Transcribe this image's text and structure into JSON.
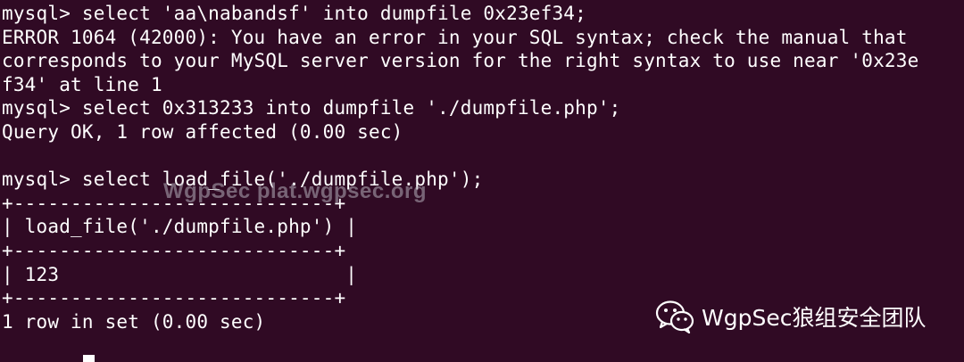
{
  "terminal": {
    "lines": [
      "mysql> select 'aa\\nabandsf' into dumpfile 0x23ef34;",
      "ERROR 1064 (42000): You have an error in your SQL syntax; check the manual that",
      "corresponds to your MySQL server version for the right syntax to use near '0x23e",
      "f34' at line 1",
      "mysql> select 0x313233 into dumpfile './dumpfile.php';",
      "Query OK, 1 row affected (0.00 sec)",
      "",
      "mysql> select load_file('./dumpfile.php');",
      "+----------------------------+",
      "| load_file('./dumpfile.php') |",
      "+----------------------------+",
      "| 123                         |",
      "+----------------------------+",
      "1 row in set (0.00 sec)"
    ],
    "background": "#300a24",
    "foreground": "#ffffff"
  },
  "watermark": {
    "text": "WgpSec plat.wgpsec.org"
  },
  "brand": {
    "icon": "wechat-icon",
    "text": "WgpSec狼组安全团队"
  }
}
